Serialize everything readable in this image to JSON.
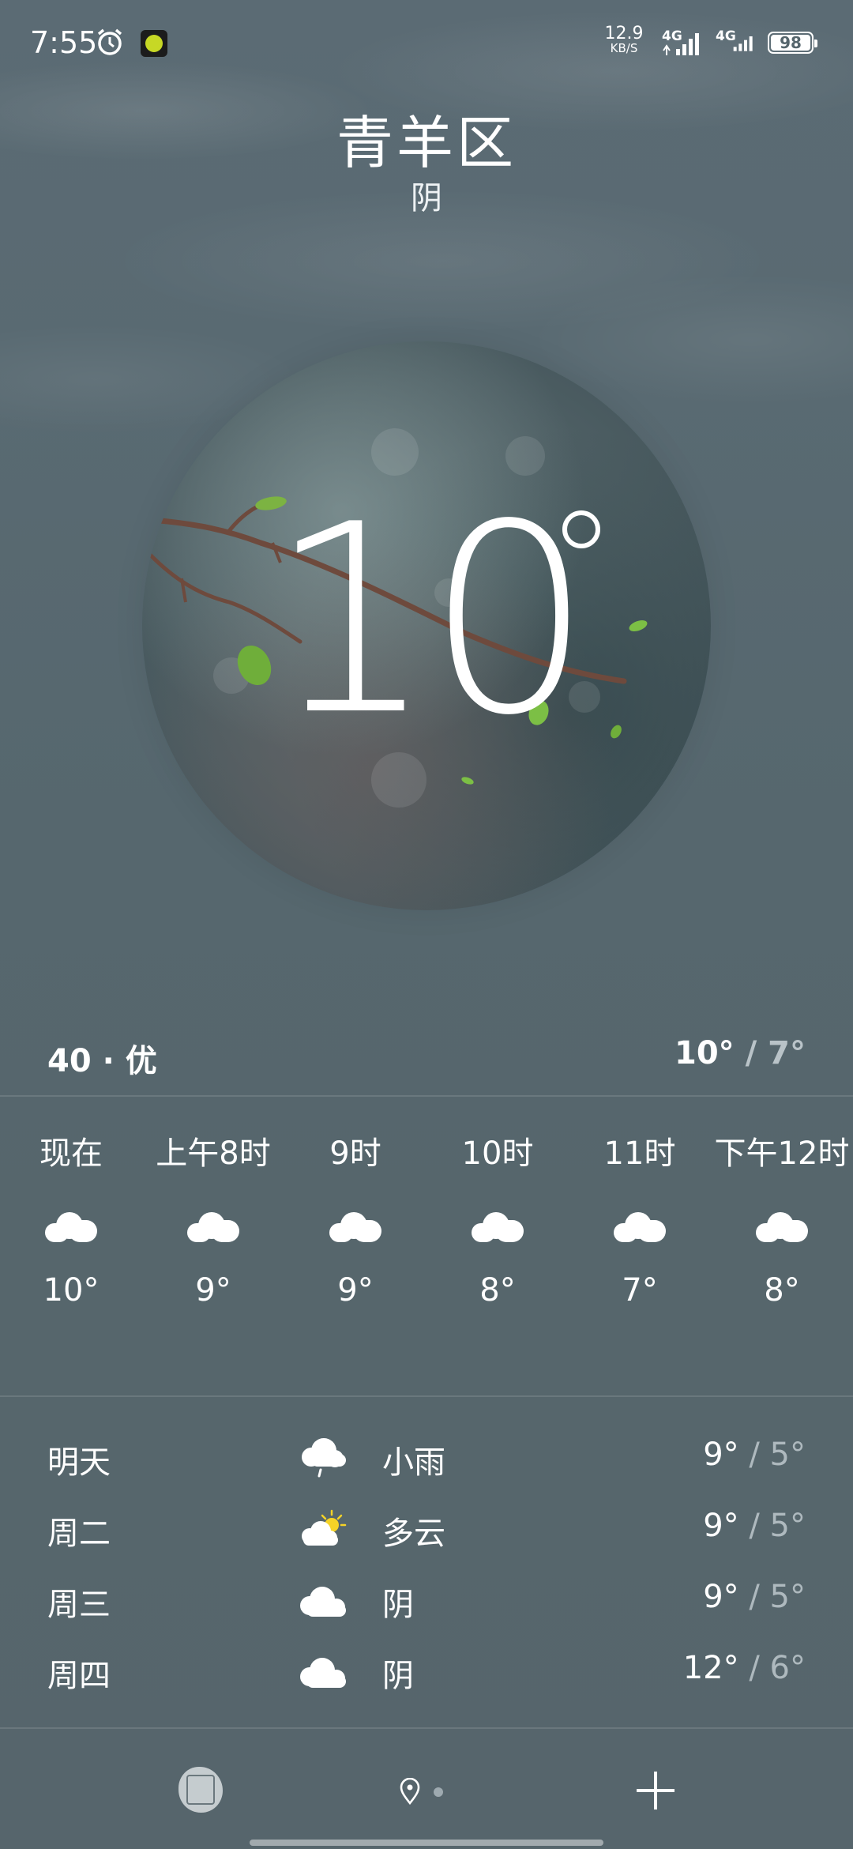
{
  "status_bar": {
    "time": "7:55",
    "net_speed_value": "12.9",
    "net_speed_unit": "KB/S",
    "signal1_label": "4G",
    "signal2_label": "4G",
    "battery": "98",
    "icons": [
      "alarm-icon",
      "app-notification-icon",
      "signal-icon",
      "battery-icon"
    ]
  },
  "header": {
    "city": "青羊区",
    "condition": "阴"
  },
  "current": {
    "temperature": "10"
  },
  "air_quality": {
    "label": "40 · 优"
  },
  "today_range": {
    "high": "10°",
    "separator": " / ",
    "low": "7°"
  },
  "hourly": [
    {
      "time": "现在",
      "icon": "cloud-icon",
      "temp": "10°"
    },
    {
      "time": "上午8时",
      "icon": "cloud-icon",
      "temp": "9°"
    },
    {
      "time": "9时",
      "icon": "cloud-icon",
      "temp": "9°"
    },
    {
      "time": "10时",
      "icon": "cloud-icon",
      "temp": "8°"
    },
    {
      "time": "11时",
      "icon": "cloud-icon",
      "temp": "7°"
    },
    {
      "time": "下午12时",
      "icon": "cloud-icon",
      "temp": "8°"
    }
  ],
  "daily": [
    {
      "day": "明天",
      "icon": "light-rain-icon",
      "condition": "小雨",
      "high": "9°",
      "separator": " / ",
      "low": "5°"
    },
    {
      "day": "周二",
      "icon": "partly-cloudy-icon",
      "condition": "多云",
      "high": "9°",
      "separator": " / ",
      "low": "5°"
    },
    {
      "day": "周三",
      "icon": "cloud-icon",
      "condition": "阴",
      "high": "9°",
      "separator": " / ",
      "low": "5°"
    },
    {
      "day": "周四",
      "icon": "cloud-icon",
      "condition": "阴",
      "high": "12°",
      "separator": " / ",
      "low": "6°"
    }
  ],
  "bottom_bar": {
    "icons": [
      "seal-logo-icon",
      "location-pin-icon",
      "add-city-icon"
    ]
  },
  "colors": {
    "background": "#56676e",
    "text": "#ffffff",
    "muted_text": "#aeb9be",
    "sun": "#f5d327"
  }
}
